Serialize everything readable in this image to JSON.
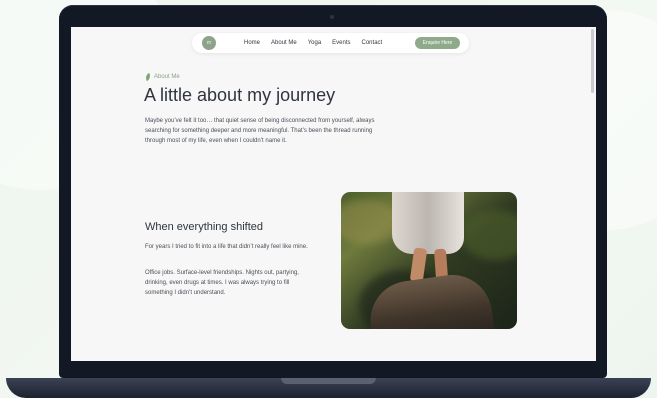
{
  "nav": {
    "logo_text": "m",
    "links": [
      "Home",
      "About Me",
      "Yoga",
      "Events",
      "Contact"
    ],
    "cta_label": "Enquire Here"
  },
  "hero": {
    "eyebrow": "About Me",
    "title": "A little about my journey",
    "intro": "Maybe you’ve felt it too… that quiet sense of being disconnected from yourself, always searching for something deeper and more meaningful. That’s been the thread running through most of my life, even when I couldn’t name it."
  },
  "story": {
    "heading": "When everything shifted",
    "paragraph_1": "For years I tried to fit into a life that didn’t really feel like mine.",
    "paragraph_2": "Office jobs. Surface-level friendships. Nights out, partying, drinking, even drugs at times. I was always trying to fill something I didn’t understand."
  },
  "colors": {
    "accent": "#8faa8b",
    "eyebrow": "#8da083",
    "heading": "#2f343d",
    "body": "#4a4f58"
  },
  "icons": {
    "eyebrow_icon": "leaf-icon",
    "camera": "camera-dot"
  }
}
